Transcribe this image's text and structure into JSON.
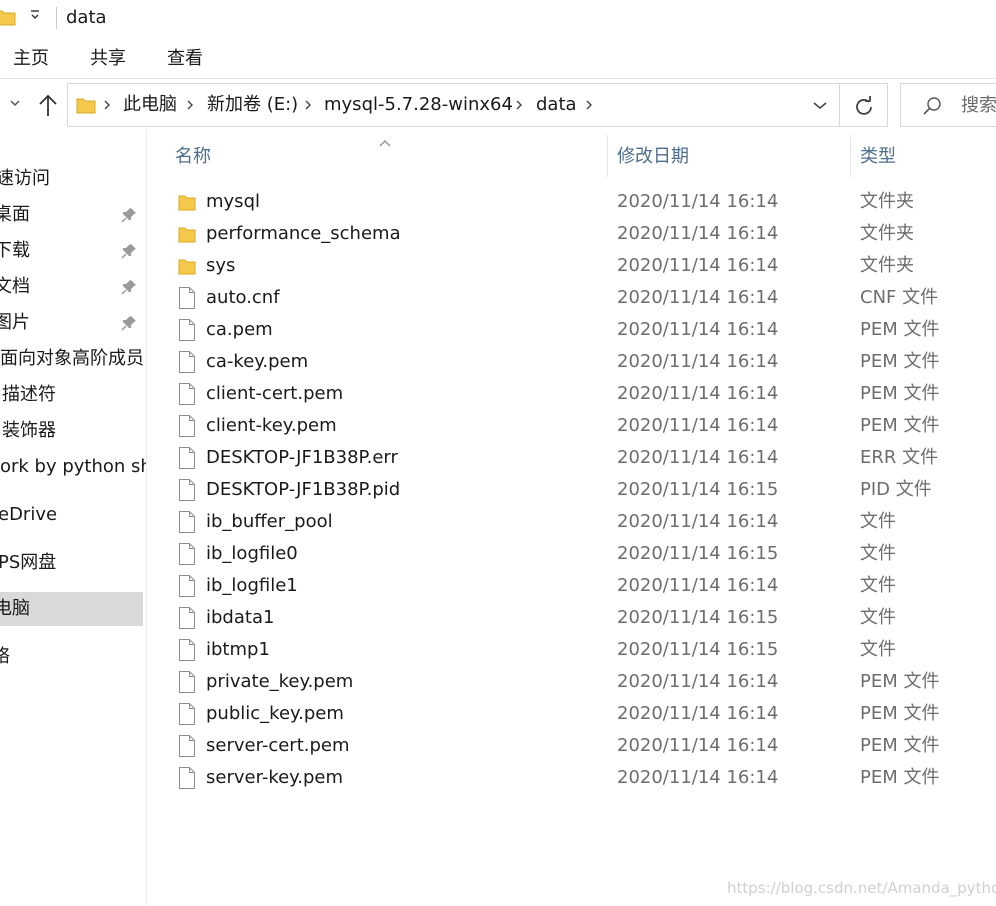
{
  "window": {
    "title": "data"
  },
  "ribbon": {
    "tabs": [
      "主页",
      "共享",
      "查看"
    ]
  },
  "address": {
    "crumbs": [
      "此电脑",
      "新加卷 (E:)",
      "mysql-5.7.28-winx64",
      "data"
    ]
  },
  "search": {
    "placeholder": "搜索"
  },
  "sidebar": {
    "items": [
      {
        "label": "速访问",
        "pinned": false
      },
      {
        "label": "桌面",
        "pinned": true
      },
      {
        "label": "下载",
        "pinned": true
      },
      {
        "label": "文档",
        "pinned": true
      },
      {
        "label": "图片",
        "pinned": true
      },
      {
        "label": "面向对象高阶成员",
        "pinned": false
      },
      {
        "label": "描述符",
        "pinned": false
      },
      {
        "label": "装饰器",
        "pinned": false
      },
      {
        "label": "ork by python sh",
        "pinned": false
      },
      {
        "label": "eDrive",
        "pinned": false
      },
      {
        "label": "PS网盘",
        "pinned": false
      },
      {
        "label": "电脑",
        "pinned": false,
        "active": true
      },
      {
        "label": "络",
        "pinned": false
      }
    ]
  },
  "columns": {
    "name": "名称",
    "modified": "修改日期",
    "type": "类型"
  },
  "files": [
    {
      "name": "mysql",
      "modified": "2020/11/14 16:14",
      "type": "文件夹",
      "icon": "folder"
    },
    {
      "name": "performance_schema",
      "modified": "2020/11/14 16:14",
      "type": "文件夹",
      "icon": "folder"
    },
    {
      "name": "sys",
      "modified": "2020/11/14 16:14",
      "type": "文件夹",
      "icon": "folder"
    },
    {
      "name": "auto.cnf",
      "modified": "2020/11/14 16:14",
      "type": "CNF 文件",
      "icon": "file"
    },
    {
      "name": "ca.pem",
      "modified": "2020/11/14 16:14",
      "type": "PEM 文件",
      "icon": "file"
    },
    {
      "name": "ca-key.pem",
      "modified": "2020/11/14 16:14",
      "type": "PEM 文件",
      "icon": "file"
    },
    {
      "name": "client-cert.pem",
      "modified": "2020/11/14 16:14",
      "type": "PEM 文件",
      "icon": "file"
    },
    {
      "name": "client-key.pem",
      "modified": "2020/11/14 16:14",
      "type": "PEM 文件",
      "icon": "file"
    },
    {
      "name": "DESKTOP-JF1B38P.err",
      "modified": "2020/11/14 16:14",
      "type": "ERR 文件",
      "icon": "file"
    },
    {
      "name": "DESKTOP-JF1B38P.pid",
      "modified": "2020/11/14 16:15",
      "type": "PID 文件",
      "icon": "file"
    },
    {
      "name": "ib_buffer_pool",
      "modified": "2020/11/14 16:14",
      "type": "文件",
      "icon": "file"
    },
    {
      "name": "ib_logfile0",
      "modified": "2020/11/14 16:15",
      "type": "文件",
      "icon": "file"
    },
    {
      "name": "ib_logfile1",
      "modified": "2020/11/14 16:14",
      "type": "文件",
      "icon": "file"
    },
    {
      "name": "ibdata1",
      "modified": "2020/11/14 16:15",
      "type": "文件",
      "icon": "file"
    },
    {
      "name": "ibtmp1",
      "modified": "2020/11/14 16:15",
      "type": "文件",
      "icon": "file"
    },
    {
      "name": "private_key.pem",
      "modified": "2020/11/14 16:14",
      "type": "PEM 文件",
      "icon": "file"
    },
    {
      "name": "public_key.pem",
      "modified": "2020/11/14 16:14",
      "type": "PEM 文件",
      "icon": "file"
    },
    {
      "name": "server-cert.pem",
      "modified": "2020/11/14 16:14",
      "type": "PEM 文件",
      "icon": "file"
    },
    {
      "name": "server-key.pem",
      "modified": "2020/11/14 16:14",
      "type": "PEM 文件",
      "icon": "file"
    }
  ],
  "watermark": "https://blog.csdn.net/Amanda_python",
  "colors": {
    "folder": "#f5c94c",
    "header_text": "#4d6e8c",
    "selected_bg": "#d9d9d9"
  }
}
